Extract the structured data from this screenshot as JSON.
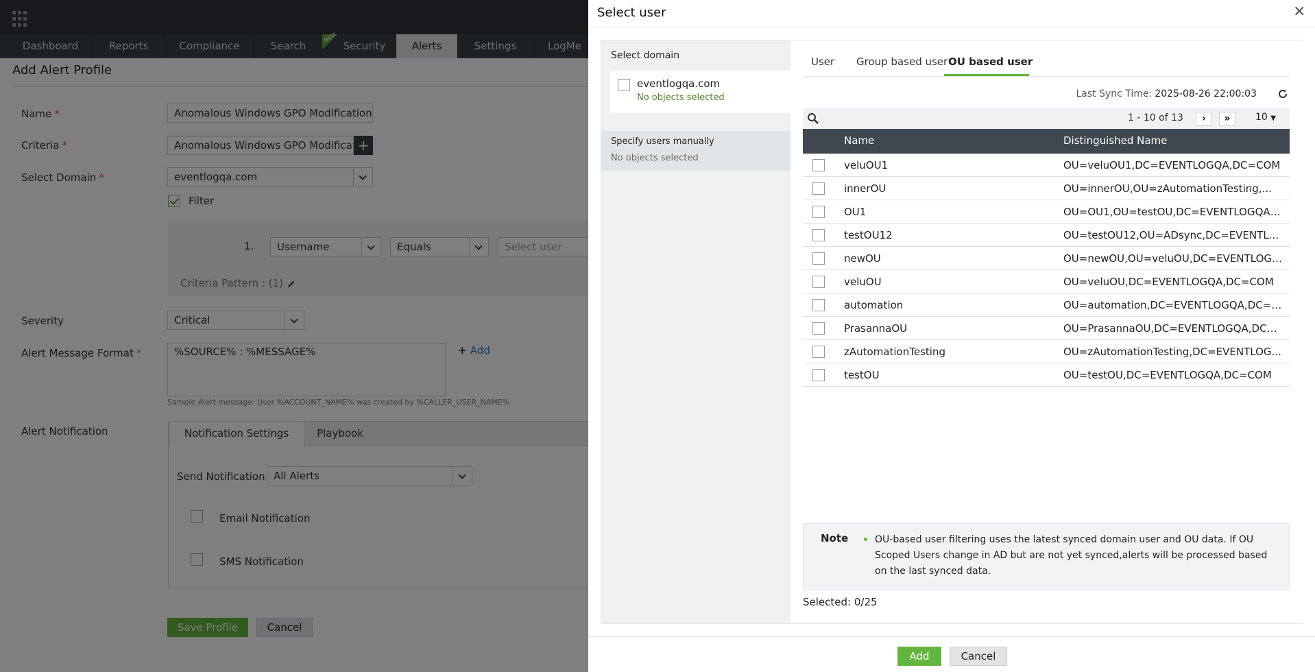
{
  "nav": {
    "tabs": [
      "Dashboard",
      "Reports",
      "Compliance",
      "Search",
      "Security",
      "Alerts",
      "Settings",
      "LogMe"
    ],
    "new_badge": "NEW"
  },
  "form": {
    "page_title": "Add Alert Profile",
    "name_label": "Name",
    "name_value": "Anomalous Windows GPO Modification",
    "criteria_label": "Criteria",
    "criteria_value": "Anomalous Windows GPO Modificatio",
    "domain_label": "Select Domain",
    "domain_value": "eventlogqa.com",
    "filter_label": "Filter",
    "row_index": "1.",
    "field_select": "Username",
    "operator_select": "Equals",
    "value_placeholder": "Select user",
    "criteria_pattern": "Criteria Pattern : (1)",
    "severity_label": "Severity",
    "severity_value": "Critical",
    "message_label": "Alert Message Format",
    "message_value": "%SOURCE% : %MESSAGE%",
    "add_link": "Add",
    "sample_message": "Sample Alert message: User %ACCOUNT_NAME% was created by %CALLER_USER_NAME%",
    "notification_label": "Alert Notification",
    "tab_notification": "Notification Settings",
    "tab_playbook": "Playbook",
    "send_notification_label": "Send Notification",
    "send_notification_value": "All Alerts",
    "email_label": "Email Notification",
    "sms_label": "SMS Notification",
    "save_button": "Save Profile",
    "cancel_button": "Cancel",
    "required_mark": "*"
  },
  "modal": {
    "title": "Select user",
    "left": {
      "heading": "Select domain",
      "domain_name": "eventlogqa.com",
      "domain_status": "No objects selected",
      "manual_heading": "Specify users manually",
      "manual_status": "No objects selected"
    },
    "tabs": [
      "User",
      "Group based user",
      "OU based user"
    ],
    "active_tab": "OU based user",
    "sync_label": "Last Sync Time:",
    "sync_value": "2025-08-26 22:00:03",
    "pager": "1 - 10 of 13",
    "page_size": "10",
    "columns": [
      "Name",
      "Distinguished Name"
    ],
    "rows": [
      {
        "name": "veluOU1",
        "dn": "OU=veluOU1,DC=EVENTLOGQA,DC=COM"
      },
      {
        "name": "innerOU",
        "dn": "OU=innerOU,OU=zAutomationTesting,..."
      },
      {
        "name": "OU1",
        "dn": "OU=OU1,OU=testOU,DC=EVENTLOGQA,DC..."
      },
      {
        "name": "testOU12",
        "dn": "OU=testOU12,OU=ADsync,DC=EVENTLOG..."
      },
      {
        "name": "newOU",
        "dn": "OU=newOU,OU=veluOU,DC=EVENTLOGQA,..."
      },
      {
        "name": "veluOU",
        "dn": "OU=veluOU,DC=EVENTLOGQA,DC=COM"
      },
      {
        "name": "automation",
        "dn": "OU=automation,DC=EVENTLOGQA,DC=COM"
      },
      {
        "name": "PrasannaOU",
        "dn": "OU=PrasannaOU,DC=EVENTLOGQA,DC=COM"
      },
      {
        "name": "zAutomationTesting",
        "dn": "OU=zAutomationTesting,DC=EVENTLOG..."
      },
      {
        "name": "testOU",
        "dn": "OU=testOU,DC=EVENTLOGQA,DC=COM"
      }
    ],
    "note_label": "Note",
    "note_text": "OU-based user filtering uses the latest synced domain user and OU data. If OU Scoped Users change in AD but are not yet synced,alerts will be processed based on the last synced data.",
    "selected": "Selected: 0/25",
    "add_button": "Add",
    "cancel_button": "Cancel"
  },
  "colors": {
    "accent_green": "#63b53d",
    "header_dark": "#3f4850",
    "required_red": "#e0552d",
    "link_blue": "#2f79c4"
  }
}
